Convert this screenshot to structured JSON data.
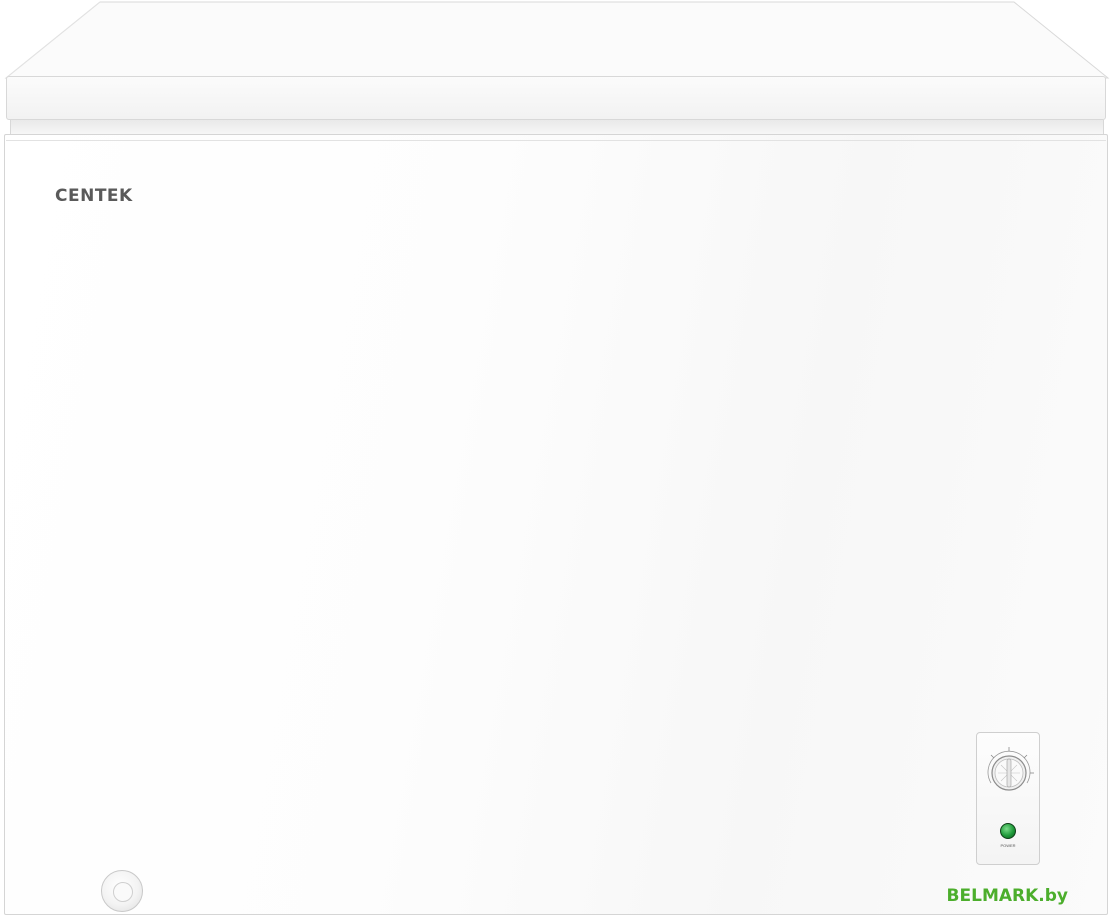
{
  "image": {
    "subject": "chest freezer",
    "colors": {
      "body": "#ffffff",
      "brand_text": "#5a5a5a",
      "power_led": "#1f9a3a",
      "watermark": "#4cae2c"
    }
  },
  "freezer": {
    "brand": "CENTEK",
    "control_panel": {
      "thermostat_knob_icon": "thermostat-dial-icon",
      "power_label": "POWER"
    },
    "drain_icon": "drain-plug-icon"
  },
  "watermark": {
    "text": "BELMARK.by"
  }
}
